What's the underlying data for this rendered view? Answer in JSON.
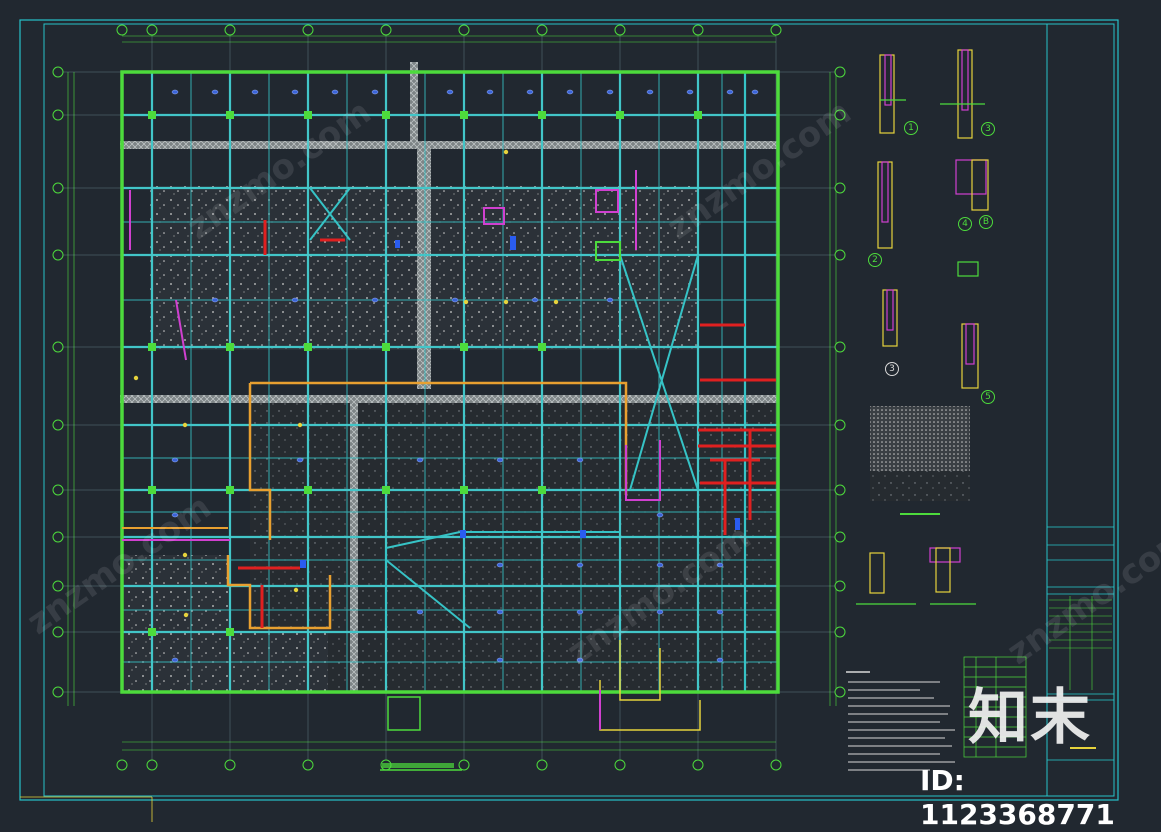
{
  "drawing": {
    "watermark_site": "znzmo.com",
    "watermark_brand": "知末",
    "watermark_id": "ID: 1123368771"
  },
  "colors": {
    "background": "#212830",
    "frame": "#27c2c9",
    "outline": "#4ddb3c",
    "beam": "#36c3c6",
    "grid": "#9fd6d8",
    "wall_red": "#e02020",
    "wall_orange": "#e8a030",
    "wall_yellow": "#e6d33c",
    "magenta": "#d040d0",
    "blue": "#2a5cf0",
    "hatch": "#bfc7c8"
  },
  "grid_bubbles": {
    "top": [
      "",
      "",
      "",
      "",
      "",
      "",
      "",
      "",
      "",
      ""
    ],
    "left": [
      "",
      "",
      "",
      "",
      "",
      "",
      "",
      "",
      "",
      "",
      "",
      "",
      ""
    ]
  },
  "detail_markers": [
    "1",
    "2",
    "3",
    "4",
    "B",
    "5",
    "3"
  ]
}
